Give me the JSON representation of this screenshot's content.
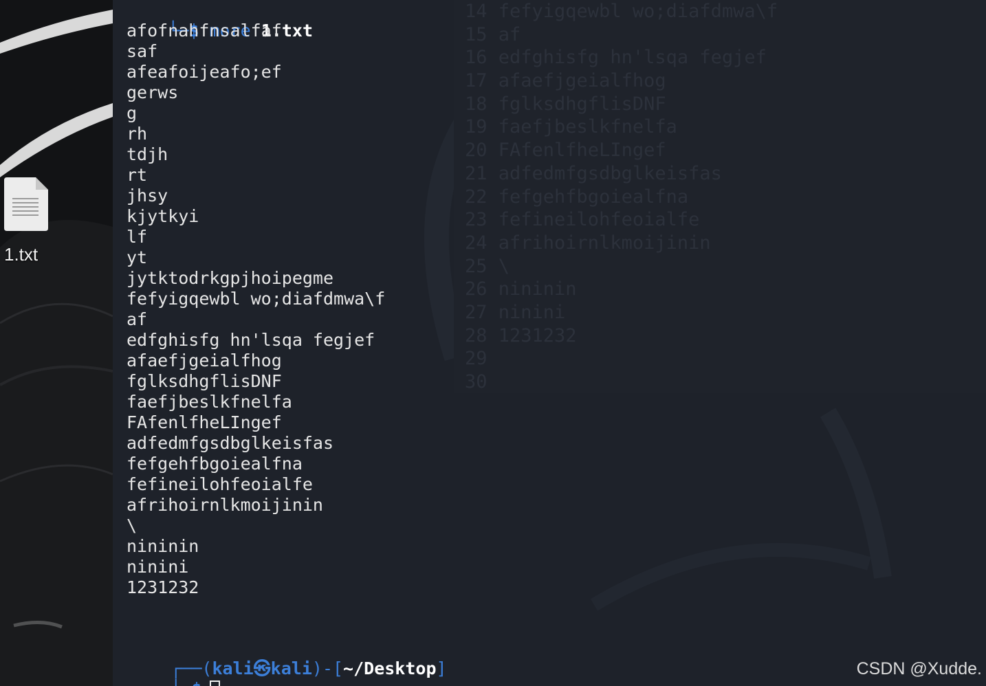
{
  "desktop": {
    "file_icon": "text-file-icon",
    "file_label": "1.txt"
  },
  "terminal": {
    "command_prompt": {
      "corner": "└─",
      "dollar": "$",
      "command": "more",
      "argument": "1.txt"
    },
    "output_lines": [
      "afofnahfnsalfaf",
      "saf",
      "afeafoijeafo;ef",
      "gerws",
      "g",
      "rh",
      "tdjh",
      "rt",
      "jhsy",
      "kjytkyi",
      "lf",
      "yt",
      "jytktodrkgpjhoipegme",
      "fefyigqewbl wo;diafdmwa\\f",
      "af",
      "edfghisfg hn'lsqa fegjef",
      "afaefjgeialfhog",
      "fglksdhgflisDNF",
      "faefjbeslkfnelfa",
      "FAfenlfheLIngef",
      "adfedmfgsdbglkeisfas",
      "fefgehfbgoiealfna",
      "fefineilohfeoialfe",
      "afrihoirnlkmoijinin",
      "\\",
      "nininin",
      "ninini",
      "1231232"
    ],
    "prompt": {
      "corner_top": "┌──",
      "open_paren": "(",
      "user": "kali",
      "at_symbol": "㉿",
      "host": "kali",
      "close_paren_dash": ")-[",
      "path": "~/Desktop",
      "close_bracket": "]",
      "corner_bottom": "└─",
      "dollar": "$"
    }
  },
  "background_editor": {
    "lines": [
      "14 fefyigqewbl wo;diafdmwa\\f",
      "15 af",
      "16 edfghisfg hn'lsqa fegjef",
      "17 afaefjgeialfhog",
      "18 fglksdhgflisDNF",
      "19 faefjbeslkfnelfa",
      "20 FAfenlfheLIngef",
      "21 adfedmfgsdbglkeisfas",
      "22 fefgehfbgoiealfna",
      "23 fefineilohfeoialfe",
      "24 afrihoirnlkmoijinin",
      "25 \\",
      "26 nininin",
      "27 ninini",
      "28 1231232",
      "29",
      "30"
    ]
  },
  "watermark": "CSDN @Xudde."
}
